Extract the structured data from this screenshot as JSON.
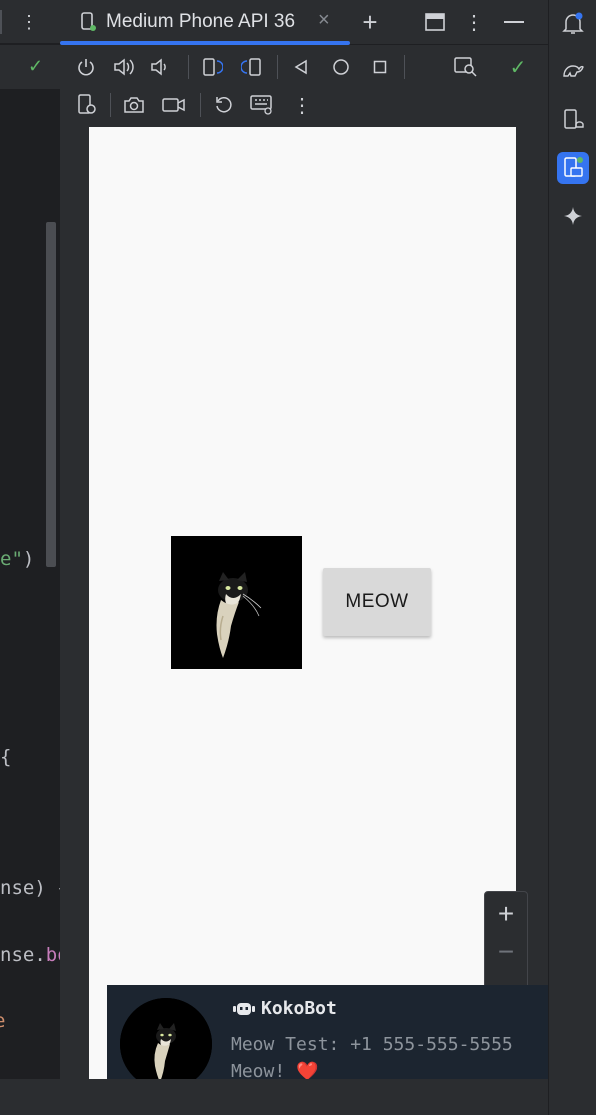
{
  "editor": {
    "lines": [
      {
        "text": "e\")"
      },
      {
        "text": "{"
      },
      {
        "text": "nse) {"
      },
      {
        "text": "nse.bo"
      },
      {
        "text": "e"
      }
    ]
  },
  "device_tab": {
    "title": "Medium Phone API 36",
    "close_glyph": "×",
    "add_glyph": "+"
  },
  "app": {
    "meow_button_label": "MEOW"
  },
  "notification": {
    "title": "KokoBot",
    "message_line1": "Meow Test: +1 555-555-5555",
    "message_line2": "Meow!",
    "heart": "❤️",
    "close_glyph": "✕"
  },
  "zoom": {
    "in_glyph": "+",
    "out_glyph": "−"
  },
  "colors": {
    "accent": "#3574f0",
    "ok_green": "#5fb865",
    "phone_bg": "#f9f9f9",
    "notif_bg": "#1c2530"
  }
}
